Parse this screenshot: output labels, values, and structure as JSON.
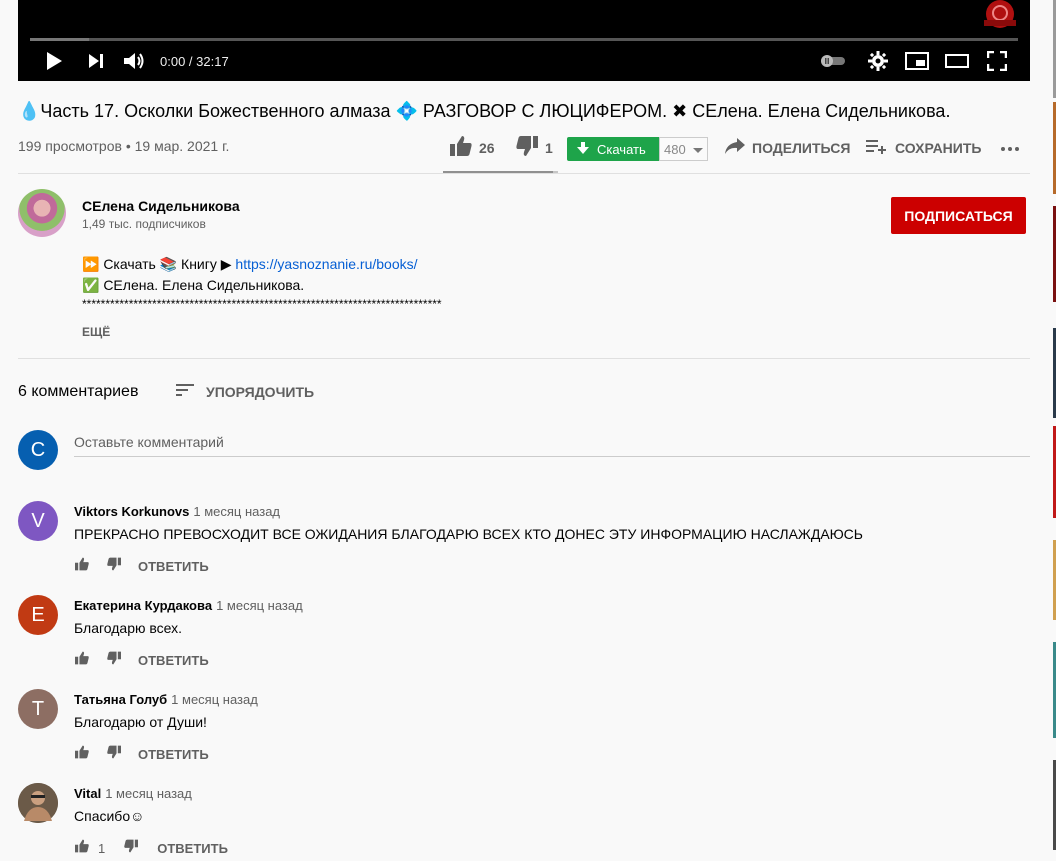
{
  "player": {
    "time": "0:00 / 32:17",
    "progress_fraction": 0.06
  },
  "video": {
    "title": "💧Часть 17. Осколки Божественного алмаза 💠 РАЗГОВОР С ЛЮЦИФЕРОМ. ✖ СЕлена. Елена Сидельникова.",
    "meta": "199 просмотров • 19 мар. 2021 г.",
    "likes": "26",
    "dislikes": "1",
    "download_label": "Скачать",
    "quality": "480",
    "share_label": "ПОДЕЛИТЬСЯ",
    "save_label": "СОХРАНИТЬ",
    "like_ratio": 0.96
  },
  "channel": {
    "name": "СЕлена Сидельникова",
    "subscribers": "1,49 тыс. подписчиков",
    "subscribe_label": "ПОДПИСАТЬСЯ"
  },
  "description": {
    "line1_prefix": "⏩ Скачать 📚 Книгу ▶ ",
    "line1_link": "https://yasnoznanie.ru/books/",
    "line2": "✅ СЕлена. Елена Сидельникова.",
    "line3": "*****************************************************************************",
    "more_label": "ЕЩЁ"
  },
  "comments_header": {
    "count": "6 комментариев",
    "sort_label": "УПОРЯДОЧИТЬ",
    "add_placeholder": "Оставьте комментарий",
    "my_initial": "C"
  },
  "comments": [
    {
      "initial": "V",
      "color": "#7e57c2",
      "author": "Viktors Korkunovs",
      "time": "1 месяц назад",
      "text": "ПРЕКРАСНО ПРЕВОСХОДИТ ВСЕ ОЖИДАНИЯ БЛАГОДАРЮ ВСЕХ КТО ДОНЕС ЭТУ ИНФОРМАЦИЮ НАСЛАЖДАЮСЬ",
      "likes": "",
      "reply": "ОТВЕТИТЬ"
    },
    {
      "initial": "Е",
      "color": "#c13a13",
      "author": "Екатерина Курдакова",
      "time": "1 месяц назад",
      "text": "Благодарю всех.",
      "likes": "",
      "reply": "ОТВЕТИТЬ"
    },
    {
      "initial": "Т",
      "color": "#8d6e63",
      "author": "Татьяна Голуб",
      "time": "1 месяц назад",
      "text": "Благодарю от Души!",
      "likes": "",
      "reply": "ОТВЕТИТЬ"
    },
    {
      "initial": "",
      "color": "#5a4a3a",
      "author": "Vital",
      "time": "1 месяц назад",
      "text": "Спасибо☺",
      "likes": "1",
      "reply": "ОТВЕТИТЬ"
    }
  ],
  "colors": {
    "accent_red": "#cc0000",
    "download_green": "#1ea44a",
    "link_blue": "#065fd4"
  }
}
